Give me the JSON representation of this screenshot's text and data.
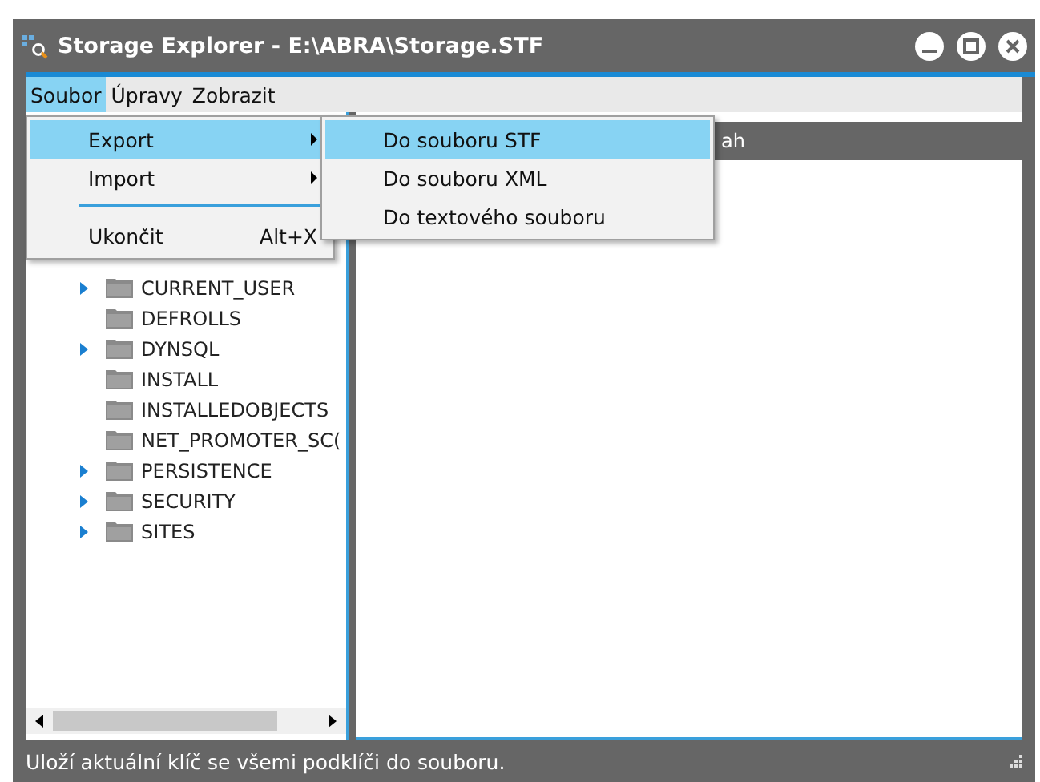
{
  "window": {
    "title": "Storage Explorer - E:\\ABRA\\Storage.STF"
  },
  "menu_bar": [
    {
      "label": "Soubor",
      "selected": true
    },
    {
      "label": "Úpravy",
      "selected": false
    },
    {
      "label": "Zobrazit",
      "selected": false
    }
  ],
  "file_menu": [
    {
      "kind": "item",
      "label": "Export",
      "submenu": true,
      "selected": true
    },
    {
      "kind": "item",
      "label": "Import",
      "submenu": true,
      "selected": false
    },
    {
      "kind": "separator"
    },
    {
      "kind": "item",
      "label": "Ukončit",
      "shortcut": "Alt+X",
      "submenu": false,
      "selected": false
    }
  ],
  "export_submenu": [
    {
      "label": "Do souboru STF",
      "selected": true
    },
    {
      "label": "Do souboru XML",
      "selected": false
    },
    {
      "label": "Do textového souboru",
      "selected": false
    }
  ],
  "tree": [
    {
      "label": "CURRENT_USER",
      "expandable": true
    },
    {
      "label": "DEFROLLS",
      "expandable": false
    },
    {
      "label": "DYNSQL",
      "expandable": true
    },
    {
      "label": "INSTALL",
      "expandable": false
    },
    {
      "label": "INSTALLEDOBJECTS",
      "expandable": false
    },
    {
      "label": "NET_PROMOTER_SC(",
      "expandable": false
    },
    {
      "label": "PERSISTENCE",
      "expandable": true
    },
    {
      "label": "SECURITY",
      "expandable": true
    },
    {
      "label": "SITES",
      "expandable": true
    }
  ],
  "detail_header": "ah",
  "status_bar": "Uloží aktuální klíč se všemi podklíči do souboru."
}
